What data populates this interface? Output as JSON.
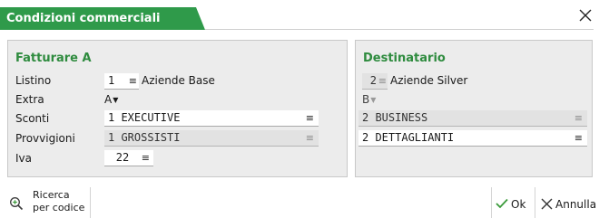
{
  "window": {
    "title": "Condizioni commerciali"
  },
  "left": {
    "title": "Fatturare A",
    "labels": {
      "listino": "Listino",
      "extra": "Extra",
      "sconti": "Sconti",
      "provvigioni": "Provvigioni",
      "iva": "Iva"
    },
    "listino": {
      "value": "1",
      "description": "Aziende Base"
    },
    "extra": {
      "value": "A"
    },
    "sconti": {
      "value": "1 EXECUTIVE"
    },
    "provvigioni": {
      "value": "1 GROSSISTI"
    },
    "iva": {
      "value": "22"
    }
  },
  "right": {
    "title": "Destinatario",
    "listino": {
      "value": "2",
      "description": "Aziende Silver"
    },
    "extra": {
      "value": "B"
    },
    "sconti": {
      "value": "2 BUSINESS"
    },
    "provvigioni": {
      "value": "2 DETTAGLIANTI"
    }
  },
  "footer": {
    "search_line1": "Ricerca",
    "search_line2": "per codice",
    "ok": "Ok",
    "cancel": "Annulla"
  },
  "icons": {
    "close": "close-icon",
    "search": "magnifier-plus-icon",
    "ok": "checkmark-icon",
    "cancel": "cross-icon",
    "lines": "lines-icon",
    "caret": "caret-down-icon"
  },
  "colors": {
    "accent": "#2f9a4a",
    "section_title": "#2e8b3e",
    "ok_check": "#3a9a3a",
    "panel": "#ececec"
  }
}
